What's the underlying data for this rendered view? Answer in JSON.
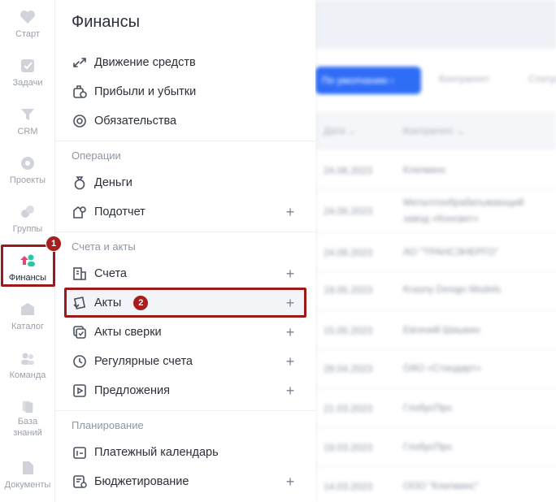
{
  "rail": {
    "items": [
      {
        "label": "Старт",
        "icon": "heart-icon"
      },
      {
        "label": "Задачи",
        "icon": "checkmark-icon"
      },
      {
        "label": "CRM",
        "icon": "funnel-icon"
      },
      {
        "label": "Проекты",
        "icon": "projects-icon"
      },
      {
        "label": "Группы",
        "icon": "groups-icon"
      },
      {
        "label": "Финансы",
        "icon": "finance-icon"
      },
      {
        "label": "Каталог",
        "icon": "catalog-icon"
      },
      {
        "label": "Команда",
        "icon": "team-icon"
      },
      {
        "label": "База знаний",
        "icon": "knowledge-base-icon"
      },
      {
        "label": "Документы",
        "icon": "documents-icon"
      }
    ]
  },
  "markers": {
    "one": "1",
    "two": "2"
  },
  "panel": {
    "title": "Финансы",
    "top_items": [
      {
        "label": "Движение средств",
        "icon": "arrows-icon"
      },
      {
        "label": "Прибыли и убытки",
        "icon": "profit-icon"
      },
      {
        "label": "Обязательства",
        "icon": "obligations-icon"
      }
    ],
    "sections": [
      {
        "title": "Операции",
        "items": [
          {
            "label": "Деньги",
            "icon": "money-bag-icon",
            "plus": false
          },
          {
            "label": "Подотчет",
            "icon": "accountable-icon",
            "plus": true
          }
        ]
      },
      {
        "title": "Счета и акты",
        "items": [
          {
            "label": "Счета",
            "icon": "invoice-icon",
            "plus": true
          },
          {
            "label": "Акты",
            "icon": "act-icon",
            "plus": true,
            "active": true
          },
          {
            "label": "Акты сверки",
            "icon": "reconciliation-icon",
            "plus": true
          },
          {
            "label": "Регулярные счета",
            "icon": "clock-icon",
            "plus": true
          },
          {
            "label": "Предложения",
            "icon": "proposal-icon",
            "plus": true
          }
        ]
      },
      {
        "title": "Планирование",
        "items": [
          {
            "label": "Платежный календарь",
            "icon": "calendar-icon",
            "plus": false
          },
          {
            "label": "Бюджетирование",
            "icon": "budget-icon",
            "plus": true
          }
        ]
      }
    ],
    "plus_symbol": "+"
  },
  "background": {
    "button_label": "По умолчанию ›",
    "chips": [
      "Контрагент",
      "Статус"
    ],
    "columns": [
      "Дата ⌄",
      "Контрагент ⌄"
    ],
    "rows": [
      {
        "date": "24.06.2023",
        "name": "Клепвинс"
      },
      {
        "date": "24.06.2023",
        "name": "Металлообрабатывающий завод «Консвет»"
      },
      {
        "date": "24.06.2023",
        "name": "АО \"ТРАНСЭНЕРГО\""
      },
      {
        "date": "19.05.2023",
        "name": "Krasny Design Models"
      },
      {
        "date": "15.05.2023",
        "name": "Евгений Шишкин"
      },
      {
        "date": "28.04.2023",
        "name": "ОАО «Стандарт»"
      },
      {
        "date": "21.03.2023",
        "name": "ГлобусПро"
      },
      {
        "date": "19.03.2023",
        "name": "ГлобусПро"
      },
      {
        "date": "14.03.2023",
        "name": "ООО \"Клепвинс\""
      }
    ]
  }
}
